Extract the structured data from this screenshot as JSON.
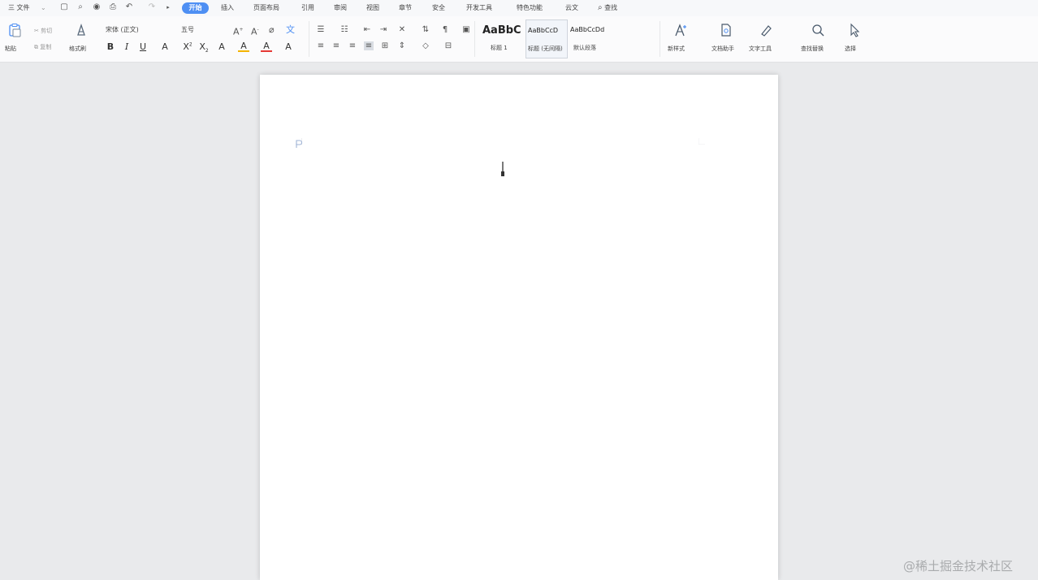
{
  "menu": {
    "app_menu_label": "三 文件",
    "tabs": [
      "开始",
      "插入",
      "页面布局",
      "引用",
      "审阅",
      "视图",
      "章节",
      "安全",
      "开发工具",
      "特色功能",
      "云文"
    ],
    "active_tab": "开始",
    "search_label": "查找"
  },
  "ribbon": {
    "clipboard": {
      "paste_label": "粘贴",
      "cut_label": "剪切",
      "copy_label": "复制",
      "format_painter_label": "格式刷"
    },
    "font": {
      "name_value": "宋体 (正文)",
      "size_value": "五号"
    },
    "styles": {
      "items": [
        {
          "preview": "AaBbC",
          "name": "标题 1"
        },
        {
          "preview": "AaBbCcD",
          "name": "标题 (无间隔)"
        },
        {
          "preview": "AaBbCcDd",
          "name": "默认段落"
        }
      ]
    },
    "new_style_label": "新样式",
    "doc_assistant_label": "文档助手",
    "text_tools_label": "文字工具",
    "find_replace_label": "查找替换",
    "select_label": "选择"
  },
  "watermark": "@稀土掘金技术社区",
  "icons": [
    "paste-icon",
    "cut-icon",
    "copy-icon",
    "format-painter-icon",
    "bold-icon",
    "italic-icon",
    "underline-icon",
    "new-style-icon",
    "doc-assistant-icon",
    "text-tools-icon",
    "find-icon",
    "select-cursor-icon",
    "text-cursor-icon"
  ],
  "colors": {
    "accent": "#4e8ff3",
    "page": "#ffffff",
    "workspace": "#e9eaec"
  }
}
